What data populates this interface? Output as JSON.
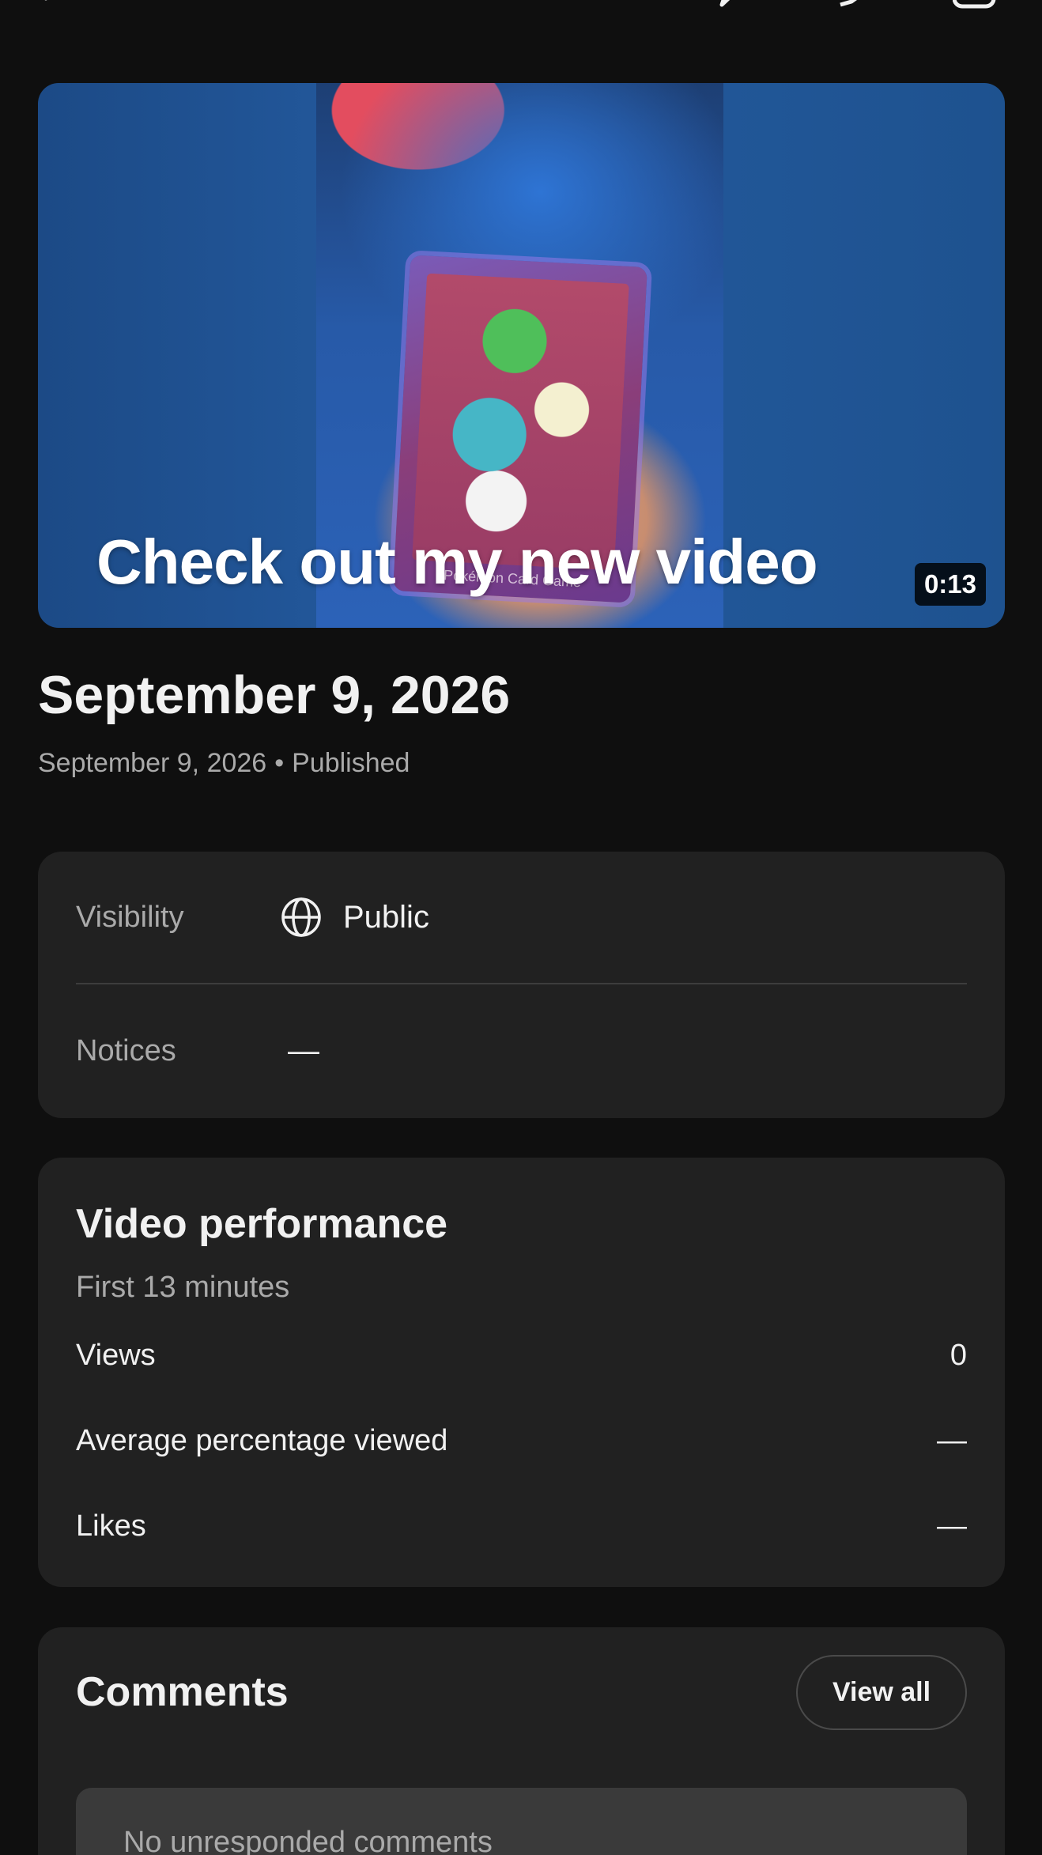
{
  "video": {
    "thumbnail_text": "Check out my new video",
    "card_text": "Pokémon Card Game",
    "duration": "0:13"
  },
  "header": {
    "title": "September 9, 2026",
    "date": "September 9, 2026",
    "separator": "•",
    "status": "Published"
  },
  "details": {
    "visibility_label": "Visibility",
    "visibility_value": "Public",
    "notices_label": "Notices",
    "notices_value": "—"
  },
  "performance": {
    "title": "Video performance",
    "period": "First 13 minutes",
    "rows": [
      {
        "label": "Views",
        "value": "0"
      },
      {
        "label": "Average percentage viewed",
        "value": "—"
      },
      {
        "label": "Likes",
        "value": "—"
      }
    ]
  },
  "comments": {
    "title": "Comments",
    "view_all": "View all",
    "empty_text": "No unresponded comments"
  },
  "icons": {
    "back": "back-arrow-icon",
    "edit": "edit-pencil-icon",
    "share": "share-icon",
    "more": "more-icon",
    "visibility": "globe-icon"
  }
}
